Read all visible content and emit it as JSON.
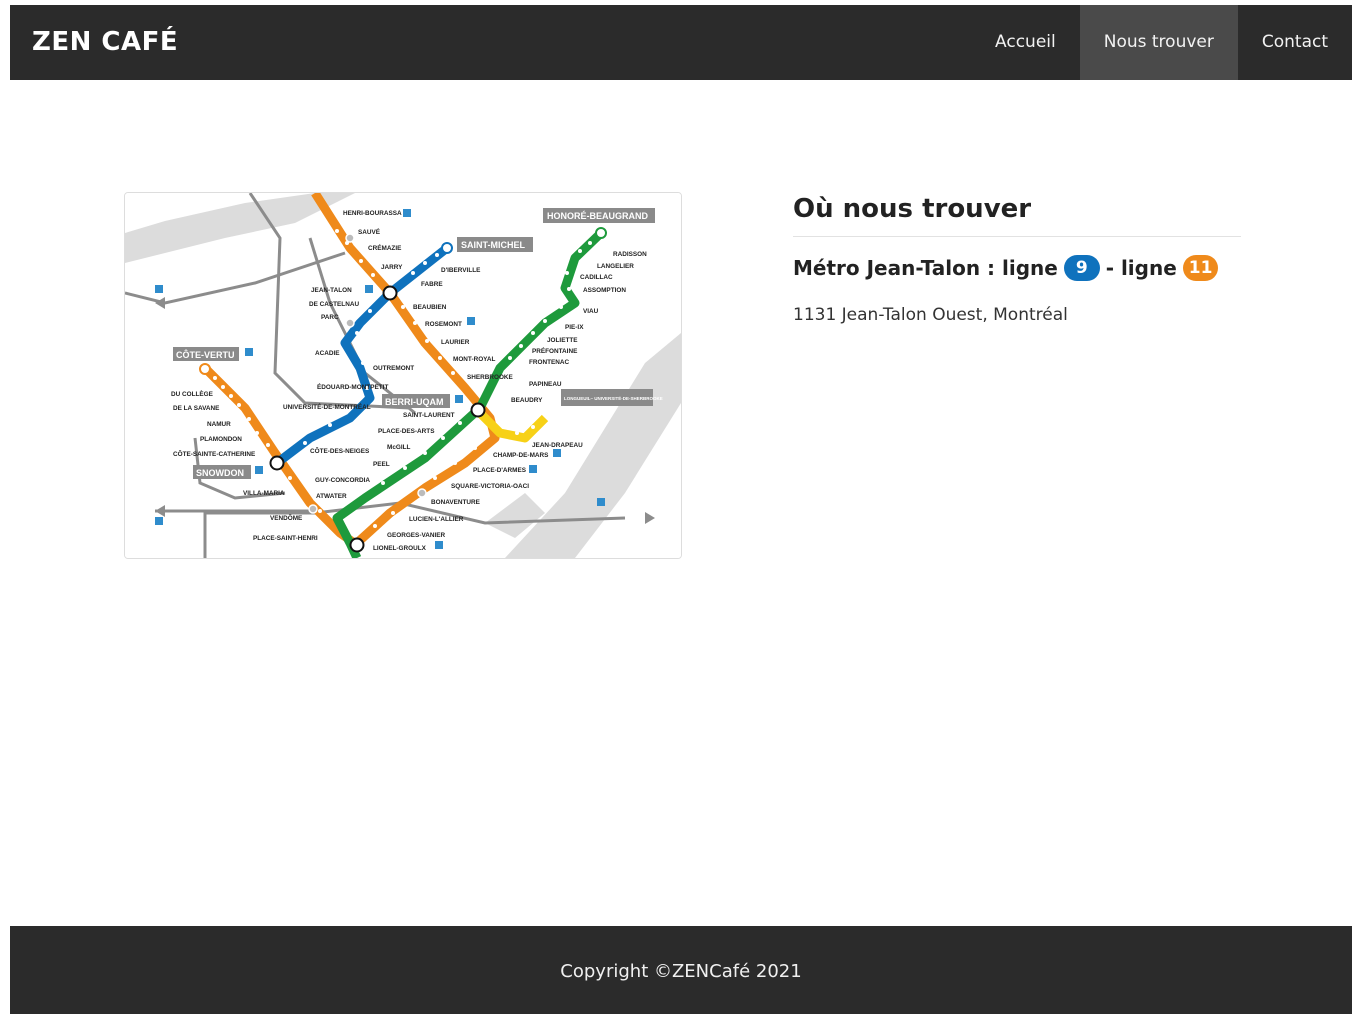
{
  "brand": "ZEN CAFÉ",
  "nav": {
    "items": [
      {
        "label": "Accueil",
        "active": false
      },
      {
        "label": "Nous trouver",
        "active": true
      },
      {
        "label": "Contact",
        "active": false
      }
    ]
  },
  "section": {
    "title": "Où nous trouver",
    "metro_label": "Métro Jean-Talon : ligne",
    "line1_number": "9",
    "separator": "- ligne",
    "line2_number": "11",
    "address": "1131 Jean-Talon Ouest, Montréal"
  },
  "colors": {
    "navbar_bg": "#2b2b2b",
    "active_nav_bg": "#4a4a4a",
    "blue_line": "#0f72bd",
    "orange_line": "#ef8a1b",
    "green_line": "#1e9a3c",
    "yellow_line": "#f7d117"
  },
  "map": {
    "stations": {
      "henri_bourassa": "HENRI-BOURASSA",
      "sauve": "SAUVÉ",
      "cremazie": "CRÉMAZIE",
      "jarry": "JARRY",
      "jean_talon": "JEAN-TALON",
      "de_castelnau": "DE CASTELNAU",
      "parc": "PARC",
      "acadie": "ACADIE",
      "outremont": "OUTREMONT",
      "edouard_montpetit": "ÉDOUARD-MONTPETIT",
      "universite_de_montreal": "UNIVERSITÉ-DE-MONTRÉAL",
      "cote_des_neiges": "CÔTE-DES-NEIGES",
      "snowdon": "SNOWDON",
      "cote_vertu": "CÔTE-VERTU",
      "du_college": "DU COLLÈGE",
      "de_la_savane": "DE LA SAVANE",
      "namur": "NAMUR",
      "plamondon": "PLAMONDON",
      "cote_sainte_catherine": "CÔTE-SAINTE-CATHERINE",
      "villa_maria": "VILLA-MARIA",
      "vendome": "VENDÔME",
      "place_saint_henri": "PLACE-SAINT-HENRI",
      "lionel_groulx": "LIONEL-GROULX",
      "georges_vanier": "GEORGES-VANIER",
      "lucien_lallier": "LUCIEN-L'ALLIER",
      "bonaventure": "BONAVENTURE",
      "square_victoria": "SQUARE-VICTORIA-OACI",
      "place_darmes": "PLACE-D'ARMES",
      "champ_de_mars": "CHAMP-DE-MARS",
      "atwater": "ATWATER",
      "guy_concordia": "GUY-CONCORDIA",
      "peel": "PEEL",
      "mcgill": "McGILL",
      "place_des_arts": "PLACE-DES-ARTS",
      "saint_laurent": "SAINT-LAURENT",
      "berri_uqam": "BERRI-UQAM",
      "beaudry": "BEAUDRY",
      "papineau": "PAPINEAU",
      "frontenac": "FRONTENAC",
      "prefontaine": "PRÉFONTAINE",
      "joliette": "JOLIETTE",
      "pie_ix": "PIE-IX",
      "viau": "VIAU",
      "assomption": "ASSOMPTION",
      "cadillac": "CADILLAC",
      "langelier": "LANGELIER",
      "radisson": "RADISSON",
      "honore_beaugrand": "HONORÉ-BEAUGRAND",
      "sherbrooke": "SHERBROOKE",
      "mont_royal": "MONT-ROYAL",
      "laurier": "LAURIER",
      "rosemont": "ROSEMONT",
      "beaubien": "BEAUBIEN",
      "fabre": "FABRE",
      "d_iberville": "D'IBERVILLE",
      "saint_michel": "SAINT-MICHEL",
      "jean_drapeau": "JEAN-DRAPEAU",
      "longueuil": "LONGUEUIL– UNIVERSITÉ-DE-SHERBROOKE"
    }
  },
  "footer": {
    "copyright": "Copyright ©ZENCafé 2021"
  }
}
